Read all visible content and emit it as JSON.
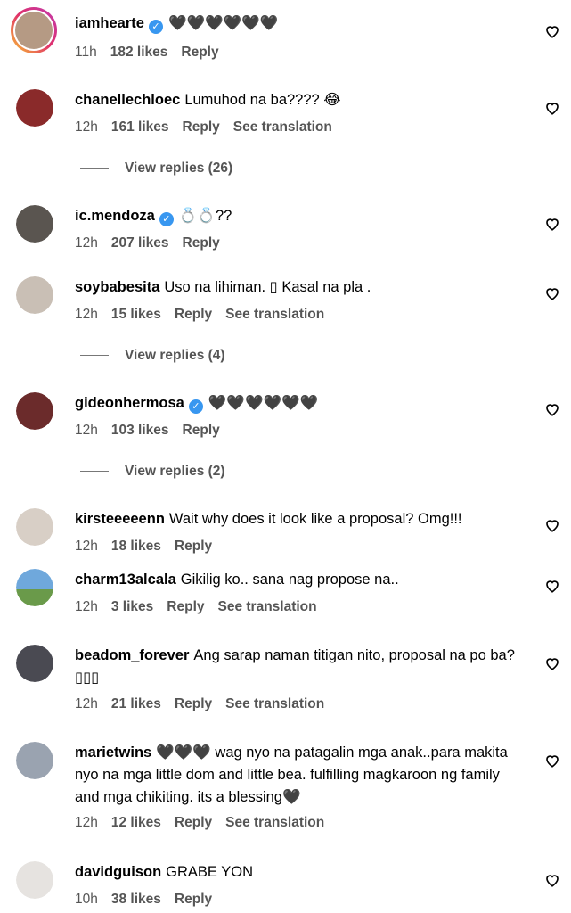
{
  "comments": [
    {
      "user": "iamhearte",
      "verified": true,
      "text": "🖤🖤🖤🖤🖤🖤",
      "time": "11h",
      "likes": "182 likes",
      "reply": "Reply",
      "translation": ""
    },
    {
      "user": "chanellechloec",
      "verified": false,
      "text": "Lumuhod na ba???? 😂",
      "time": "12h",
      "likes": "161 likes",
      "reply": "Reply",
      "translation": "See translation",
      "view_replies": "View replies (26)"
    },
    {
      "user": "ic.mendoza",
      "verified": true,
      "text": "💍💍??",
      "time": "12h",
      "likes": "207 likes",
      "reply": "Reply",
      "translation": ""
    },
    {
      "user": "soybabesita",
      "verified": false,
      "text": "Uso na lihiman. ▯ Kasal na pla .",
      "time": "12h",
      "likes": "15 likes",
      "reply": "Reply",
      "translation": "See translation",
      "view_replies": "View replies (4)"
    },
    {
      "user": "gideonhermosa",
      "verified": true,
      "text": "🖤🖤🖤🖤🖤🖤",
      "time": "12h",
      "likes": "103 likes",
      "reply": "Reply",
      "translation": "",
      "view_replies": "View replies (2)"
    },
    {
      "user": "kirsteeeeenn",
      "verified": false,
      "text": "Wait why does it look like a proposal? Omg!!!",
      "time": "12h",
      "likes": "18 likes",
      "reply": "Reply",
      "translation": ""
    },
    {
      "user": "charm13alcala",
      "verified": false,
      "text": "Gikilig ko.. sana nag propose na..",
      "time": "12h",
      "likes": "3 likes",
      "reply": "Reply",
      "translation": "See translation"
    },
    {
      "user": "beadom_forever",
      "verified": false,
      "text": "Ang sarap naman titigan nito, proposal na po ba? ▯▯▯",
      "time": "12h",
      "likes": "21 likes",
      "reply": "Reply",
      "translation": "See translation"
    },
    {
      "user": "marietwins",
      "verified": false,
      "text": "🖤🖤🖤 wag nyo na patagalin mga anak..para makita nyo na mga little dom and little bea. fulfilling magkaroon ng family and mga chikiting. its a blessing🖤",
      "time": "12h",
      "likes": "12 likes",
      "reply": "Reply",
      "translation": "See translation"
    },
    {
      "user": "davidguison",
      "verified": false,
      "text": "GRABE YON",
      "time": "10h",
      "likes": "38 likes",
      "reply": "Reply",
      "translation": ""
    }
  ],
  "colors": {
    "verified": "#3897f0",
    "meta": "#555555",
    "ring_start": "#f9c431",
    "ring_end": "#c03bb0"
  }
}
